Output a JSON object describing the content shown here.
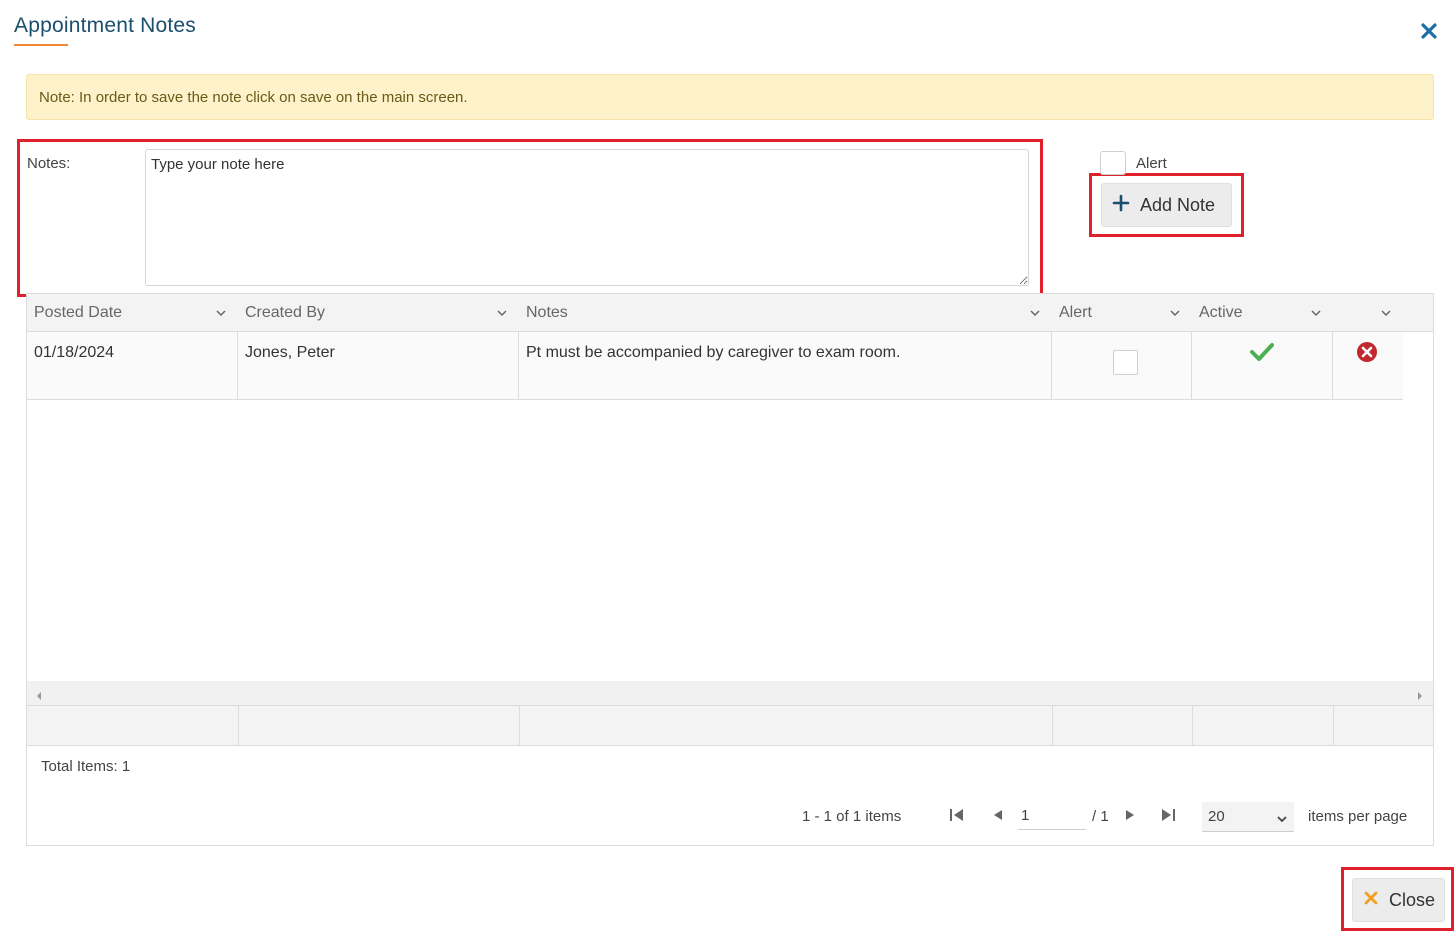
{
  "dialog": {
    "title": "Appointment Notes"
  },
  "banner": {
    "text": "Note: In order to save the note click on save on the main screen."
  },
  "form": {
    "notes_label": "Notes:",
    "notes_placeholder": "Type your note here",
    "alert_label": "Alert",
    "add_note_label": "Add Note"
  },
  "grid": {
    "columns": [
      "Posted Date",
      "Created By",
      "Notes",
      "Alert",
      "Active",
      ""
    ],
    "rows": [
      {
        "posted_date": "01/18/2024",
        "created_by": "Jones, Peter",
        "notes": "Pt must be accompanied by caregiver to exam room.",
        "alert": false,
        "active": true
      }
    ]
  },
  "footer": {
    "total_items": "Total Items: 1",
    "pager_summary": "1 - 1 of 1 items",
    "current_page": "1",
    "page_total": "/ 1",
    "page_size": "20",
    "per_page_label": "items per page"
  },
  "actions": {
    "close_label": "Close"
  },
  "colors": {
    "accent": "#1a4f6e",
    "highlight": "#e0202a",
    "check": "#4caf50",
    "delete": "#c0282d",
    "close_x": "#f0a020"
  }
}
